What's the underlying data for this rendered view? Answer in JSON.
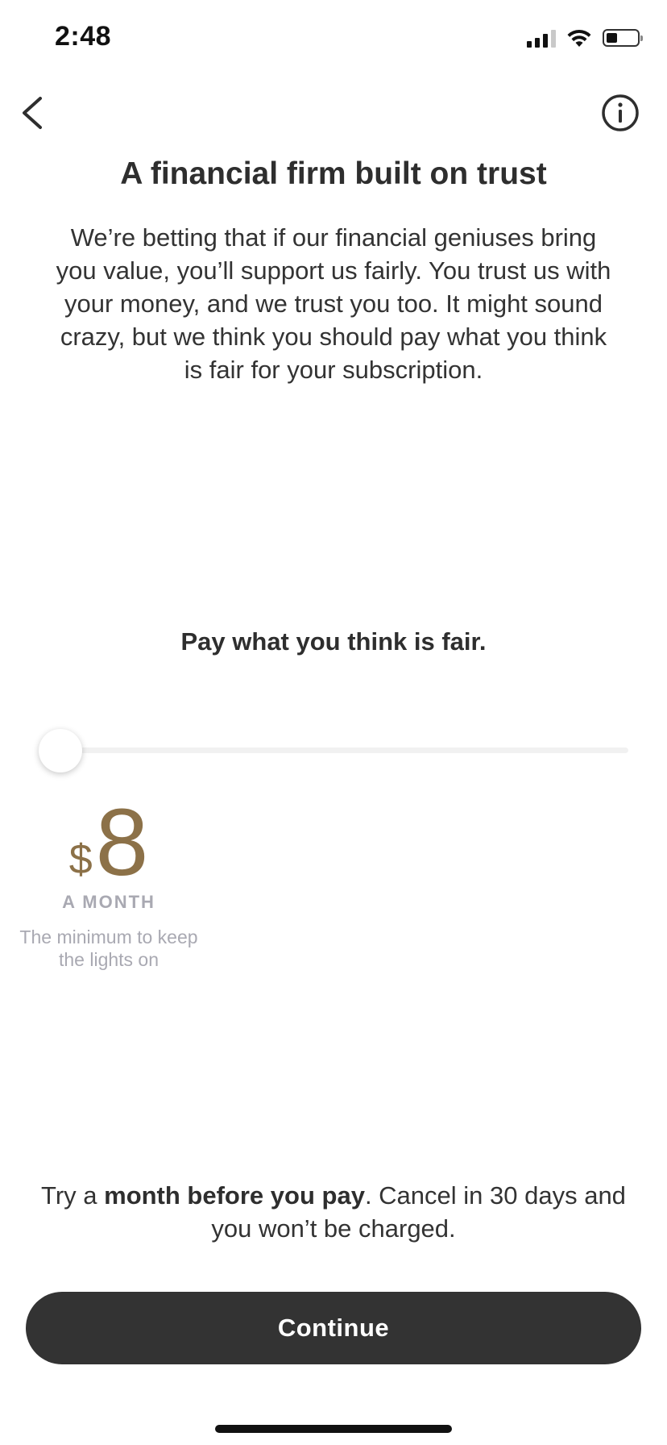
{
  "status_bar": {
    "time": "2:48",
    "icons": [
      "cellular-signal-icon",
      "wifi-icon",
      "battery-icon"
    ]
  },
  "nav": {
    "back_icon": "chevron-left-icon",
    "info_icon": "info-circle-icon"
  },
  "header": {
    "title": "A financial firm built on trust"
  },
  "intro": {
    "text": "We’re betting that if our financial geniuses bring you value, you’ll support us fairly. You trust us with your money, and we trust you too. It might sound crazy, but we think you should pay what you think is fair for your subscription."
  },
  "pricing": {
    "prompt": "Pay what you think is fair.",
    "slider_level_fraction": 0.0,
    "currency_symbol": "$",
    "amount": "8",
    "period": "A MONTH",
    "caption": "The minimum to keep the lights on"
  },
  "trial": {
    "prefix": "Try a ",
    "bold": "month before you pay",
    "suffix": ". Cancel in 30 days and you won’t be charged."
  },
  "actions": {
    "continue_label": "Continue"
  },
  "colors": {
    "accent_gold": "#8c7148",
    "button_dark": "#333333",
    "muted_text": "#a9a9b2"
  }
}
